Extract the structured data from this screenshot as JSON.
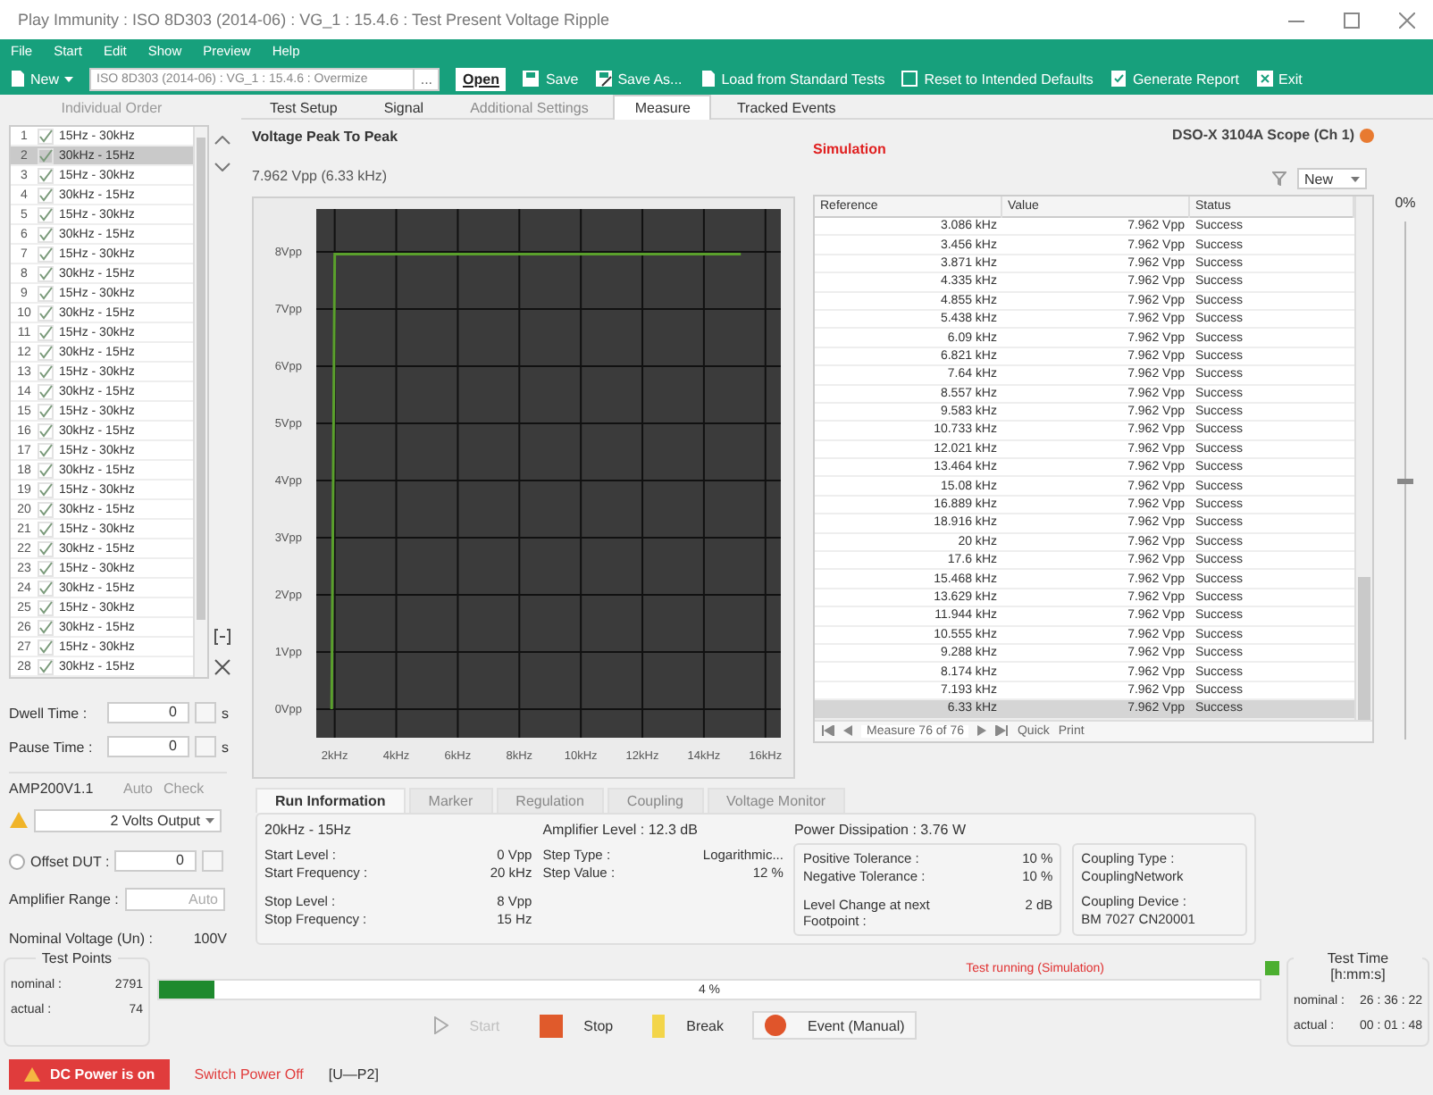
{
  "window": {
    "title": "Play Immunity : ISO 8D303 (2014-06) : VG_1 : 15.4.6 : Test Present Voltage Ripple"
  },
  "menu": [
    "File",
    "Start",
    "Edit",
    "Show",
    "Preview",
    "Help"
  ],
  "toolbar": {
    "new": "New",
    "test_path": "ISO 8D303 (2014-06) : VG_1 : 15.4.6 : Overmize",
    "browse": "...",
    "open": "Open",
    "buttons": [
      {
        "kind": "save",
        "label": "Save"
      },
      {
        "kind": "save_as",
        "label": "Save As..."
      },
      {
        "kind": "load",
        "label": "Load from Standard Tests"
      },
      {
        "kind": "reset",
        "label": "Reset to Intended Defaults"
      },
      {
        "kind": "report",
        "label": "Generate Report"
      },
      {
        "kind": "exit",
        "label": "Exit"
      }
    ]
  },
  "sequence": {
    "title": "Individual Order",
    "items": [
      {
        "number": "1",
        "checked": true,
        "label": "15Hz - 30kHz",
        "selected": false
      },
      {
        "number": "2",
        "checked": true,
        "label": "30kHz - 15Hz",
        "selected": true
      },
      {
        "number": "3",
        "checked": true,
        "label": "15Hz - 30kHz",
        "selected": false
      },
      {
        "number": "4",
        "checked": true,
        "label": "30kHz - 15Hz",
        "selected": false
      },
      {
        "number": "5",
        "checked": true,
        "label": "15Hz - 30kHz",
        "selected": false
      },
      {
        "number": "6",
        "checked": true,
        "label": "30kHz - 15Hz",
        "selected": false
      },
      {
        "number": "7",
        "checked": true,
        "label": "15Hz - 30kHz",
        "selected": false
      },
      {
        "number": "8",
        "checked": true,
        "label": "30kHz - 15Hz",
        "selected": false
      },
      {
        "number": "9",
        "checked": true,
        "label": "15Hz - 30kHz",
        "selected": false
      },
      {
        "number": "10",
        "checked": true,
        "label": "30kHz - 15Hz",
        "selected": false
      },
      {
        "number": "11",
        "checked": true,
        "label": "15Hz - 30kHz",
        "selected": false
      },
      {
        "number": "12",
        "checked": true,
        "label": "30kHz - 15Hz",
        "selected": false
      },
      {
        "number": "13",
        "checked": true,
        "label": "15Hz - 30kHz",
        "selected": false
      },
      {
        "number": "14",
        "checked": true,
        "label": "30kHz - 15Hz",
        "selected": false
      },
      {
        "number": "15",
        "checked": true,
        "label": "15Hz - 30kHz",
        "selected": false
      },
      {
        "number": "16",
        "checked": true,
        "label": "30kHz - 15Hz",
        "selected": false
      },
      {
        "number": "17",
        "checked": true,
        "label": "15Hz - 30kHz",
        "selected": false
      },
      {
        "number": "18",
        "checked": true,
        "label": "30kHz - 15Hz",
        "selected": false
      },
      {
        "number": "19",
        "checked": true,
        "label": "15Hz - 30kHz",
        "selected": false
      },
      {
        "number": "20",
        "checked": true,
        "label": "30kHz - 15Hz",
        "selected": false
      },
      {
        "number": "21",
        "checked": true,
        "label": "15Hz - 30kHz",
        "selected": false
      },
      {
        "number": "22",
        "checked": true,
        "label": "30kHz - 15Hz",
        "selected": false
      },
      {
        "number": "23",
        "checked": true,
        "label": "15Hz - 30kHz",
        "selected": false
      },
      {
        "number": "24",
        "checked": true,
        "label": "30kHz - 15Hz",
        "selected": false
      },
      {
        "number": "25",
        "checked": true,
        "label": "15Hz - 30kHz",
        "selected": false
      },
      {
        "number": "26",
        "checked": true,
        "label": "30kHz - 15Hz",
        "selected": false
      },
      {
        "number": "27",
        "checked": true,
        "label": "15Hz - 30kHz",
        "selected": false
      },
      {
        "number": "28",
        "checked": true,
        "label": "30kHz - 15Hz",
        "selected": false
      }
    ]
  },
  "settings": {
    "dwell_time": {
      "label": "Dwell Time :",
      "value": "0",
      "unit": "s"
    },
    "pause_time": {
      "label": "Pause Time :",
      "value": "0",
      "unit": "s"
    },
    "amplifier": {
      "name": "AMP200V1.1",
      "actions": [
        {
          "label": "Auto",
          "disabled": true
        },
        {
          "label": "Check",
          "disabled": true
        }
      ],
      "output": "2 Volts Output"
    },
    "offset": {
      "label": "Offset DUT :",
      "checked": false,
      "value": "0"
    },
    "amplifier_range": {
      "label": "Amplifier Range :",
      "value": "Auto"
    },
    "nominal_voltage": {
      "label": "Nominal Voltage (Un) :",
      "value": "100V"
    }
  },
  "tabs": [
    {
      "label": "Test Setup",
      "selected": false,
      "disabled": false
    },
    {
      "label": "Signal",
      "selected": false,
      "disabled": false
    },
    {
      "label": "Additional Settings",
      "selected": false,
      "disabled": true
    },
    {
      "label": "Measure",
      "selected": true,
      "disabled": false
    },
    {
      "label": "Tracked Events",
      "selected": false,
      "disabled": false
    }
  ],
  "measurement": {
    "title": "Voltage Peak To Peak",
    "reading": "7.962 Vpp (6.33 kHz)",
    "chart_data": {
      "type": "line",
      "x": [
        1.9,
        2,
        15.2
      ],
      "series": [
        {
          "color": "#5aa02c",
          "values": [
            0,
            7.96,
            7.96
          ]
        }
      ],
      "grid": true,
      "xlim": [
        1.4,
        16.5
      ],
      "ylim": [
        -0.5,
        8.75
      ],
      "xticks": [
        {
          "value": 2,
          "label": "2kHz"
        },
        {
          "value": 4,
          "label": "4kHz"
        },
        {
          "value": 6,
          "label": "6kHz"
        },
        {
          "value": 8,
          "label": "8kHz"
        },
        {
          "value": 10,
          "label": "10kHz"
        },
        {
          "value": 12,
          "label": "12kHz"
        },
        {
          "value": 14,
          "label": "14kHz"
        },
        {
          "value": 16,
          "label": "16kHz"
        }
      ],
      "yticks": [
        {
          "value": 0,
          "label": "0Vpp"
        },
        {
          "value": 1,
          "label": "1Vpp"
        },
        {
          "value": 2,
          "label": "2Vpp"
        },
        {
          "value": 3,
          "label": "3Vpp"
        },
        {
          "value": 4,
          "label": "4Vpp"
        },
        {
          "value": 5,
          "label": "5Vpp"
        },
        {
          "value": 6,
          "label": "6Vpp"
        },
        {
          "value": 7,
          "label": "7Vpp"
        },
        {
          "value": 8,
          "label": "8Vpp"
        }
      ]
    }
  },
  "results": {
    "mode": "Simulation",
    "instrument": "DSO-X 3104A Scope (Ch 1)",
    "view": "New",
    "columns": [
      "Reference",
      "Value",
      "Status"
    ],
    "rows": [
      {
        "reference": "3.086 kHz",
        "value": "7.962 Vpp",
        "status": "Success",
        "selected": false
      },
      {
        "reference": "3.456 kHz",
        "value": "7.962 Vpp",
        "status": "Success",
        "selected": false
      },
      {
        "reference": "3.871 kHz",
        "value": "7.962 Vpp",
        "status": "Success",
        "selected": false
      },
      {
        "reference": "4.335 kHz",
        "value": "7.962 Vpp",
        "status": "Success",
        "selected": false
      },
      {
        "reference": "4.855 kHz",
        "value": "7.962 Vpp",
        "status": "Success",
        "selected": false
      },
      {
        "reference": "5.438 kHz",
        "value": "7.962 Vpp",
        "status": "Success",
        "selected": false
      },
      {
        "reference": "6.09 kHz",
        "value": "7.962 Vpp",
        "status": "Success",
        "selected": false
      },
      {
        "reference": "6.821 kHz",
        "value": "7.962 Vpp",
        "status": "Success",
        "selected": false
      },
      {
        "reference": "7.64 kHz",
        "value": "7.962 Vpp",
        "status": "Success",
        "selected": false
      },
      {
        "reference": "8.557 kHz",
        "value": "7.962 Vpp",
        "status": "Success",
        "selected": false
      },
      {
        "reference": "9.583 kHz",
        "value": "7.962 Vpp",
        "status": "Success",
        "selected": false
      },
      {
        "reference": "10.733 kHz",
        "value": "7.962 Vpp",
        "status": "Success",
        "selected": false
      },
      {
        "reference": "12.021 kHz",
        "value": "7.962 Vpp",
        "status": "Success",
        "selected": false
      },
      {
        "reference": "13.464 kHz",
        "value": "7.962 Vpp",
        "status": "Success",
        "selected": false
      },
      {
        "reference": "15.08 kHz",
        "value": "7.962 Vpp",
        "status": "Success",
        "selected": false
      },
      {
        "reference": "16.889 kHz",
        "value": "7.962 Vpp",
        "status": "Success",
        "selected": false
      },
      {
        "reference": "18.916 kHz",
        "value": "7.962 Vpp",
        "status": "Success",
        "selected": false
      },
      {
        "reference": "20 kHz",
        "value": "7.962 Vpp",
        "status": "Success",
        "selected": false
      },
      {
        "reference": "17.6 kHz",
        "value": "7.962 Vpp",
        "status": "Success",
        "selected": false
      },
      {
        "reference": "15.468 kHz",
        "value": "7.962 Vpp",
        "status": "Success",
        "selected": false
      },
      {
        "reference": "13.629 kHz",
        "value": "7.962 Vpp",
        "status": "Success",
        "selected": false
      },
      {
        "reference": "11.944 kHz",
        "value": "7.962 Vpp",
        "status": "Success",
        "selected": false
      },
      {
        "reference": "10.555 kHz",
        "value": "7.962 Vpp",
        "status": "Success",
        "selected": false
      },
      {
        "reference": "9.288 kHz",
        "value": "7.962 Vpp",
        "status": "Success",
        "selected": false
      },
      {
        "reference": "8.174 kHz",
        "value": "7.962 Vpp",
        "status": "Success",
        "selected": false
      },
      {
        "reference": "7.193 kHz",
        "value": "7.962 Vpp",
        "status": "Success",
        "selected": false
      },
      {
        "reference": "6.33 kHz",
        "value": "7.962 Vpp",
        "status": "Success",
        "selected": true
      }
    ],
    "navigator": {
      "position": "Measure 76 of 76",
      "actions": [
        "Quick",
        "Print"
      ]
    }
  },
  "zoom": {
    "label": "0%",
    "level": 0.5
  },
  "run_info": {
    "tabs": [
      {
        "label": "Run Information",
        "selected": true,
        "disabled": false
      },
      {
        "label": "Marker",
        "selected": false,
        "disabled": true
      },
      {
        "label": "Regulation",
        "selected": false,
        "disabled": true
      },
      {
        "label": "Coupling",
        "selected": false,
        "disabled": true
      },
      {
        "label": "Voltage Monitor",
        "selected": false,
        "disabled": true
      }
    ],
    "headers": [
      "20kHz - 15Hz",
      "Amplifier Level : 12.3 dB",
      "Power Dissipation : 3.76 W"
    ],
    "groups": [
      [
        {
          "label": "Start Level :",
          "value": "0 Vpp"
        },
        {
          "label": "Start Frequency :",
          "value": "20 kHz"
        },
        {
          "label": "Stop Level :",
          "value": "8 Vpp"
        },
        {
          "label": "Stop Frequency :",
          "value": "15 Hz"
        }
      ],
      [
        {
          "label": "Step Type :",
          "value": "Logarithmic..."
        },
        {
          "label": "Step Value :",
          "value": "12 %"
        }
      ],
      [
        {
          "label": "Positive Tolerance :",
          "value": "10 %"
        },
        {
          "label": "Negative Tolerance :",
          "value": "10 %"
        },
        {
          "label": "Level Change at next Footpoint :",
          "value": "2 dB"
        }
      ]
    ],
    "coupling": [
      "Coupling Type :",
      "CouplingNetwork",
      "Coupling Device :",
      "BM 7027 CN20001"
    ]
  },
  "test_points": {
    "title": "Test Points",
    "rows": [
      {
        "label": "nominal :",
        "value": "2791"
      },
      {
        "label": "actual :",
        "value": "74"
      }
    ]
  },
  "progress": {
    "status": "Test running (Simulation)",
    "level": 0.05,
    "percent": "4 %"
  },
  "controls": [
    {
      "kind": "start",
      "label": "Start",
      "disabled": true
    },
    {
      "kind": "stop",
      "label": "Stop",
      "disabled": false
    },
    {
      "kind": "break",
      "label": "Break",
      "disabled": false
    },
    {
      "kind": "event",
      "label": "Event (Manual)",
      "disabled": false
    }
  ],
  "test_time": {
    "title": "Test Time [h:mm:s]",
    "rows": [
      {
        "label": "nominal :",
        "value": "26 : 36 : 22"
      },
      {
        "label": "actual :",
        "value": "00 : 01 : 48"
      }
    ]
  },
  "status_bar": {
    "power": "DC Power is on",
    "switch": "Switch Power Off",
    "port": "[U—P2]"
  }
}
